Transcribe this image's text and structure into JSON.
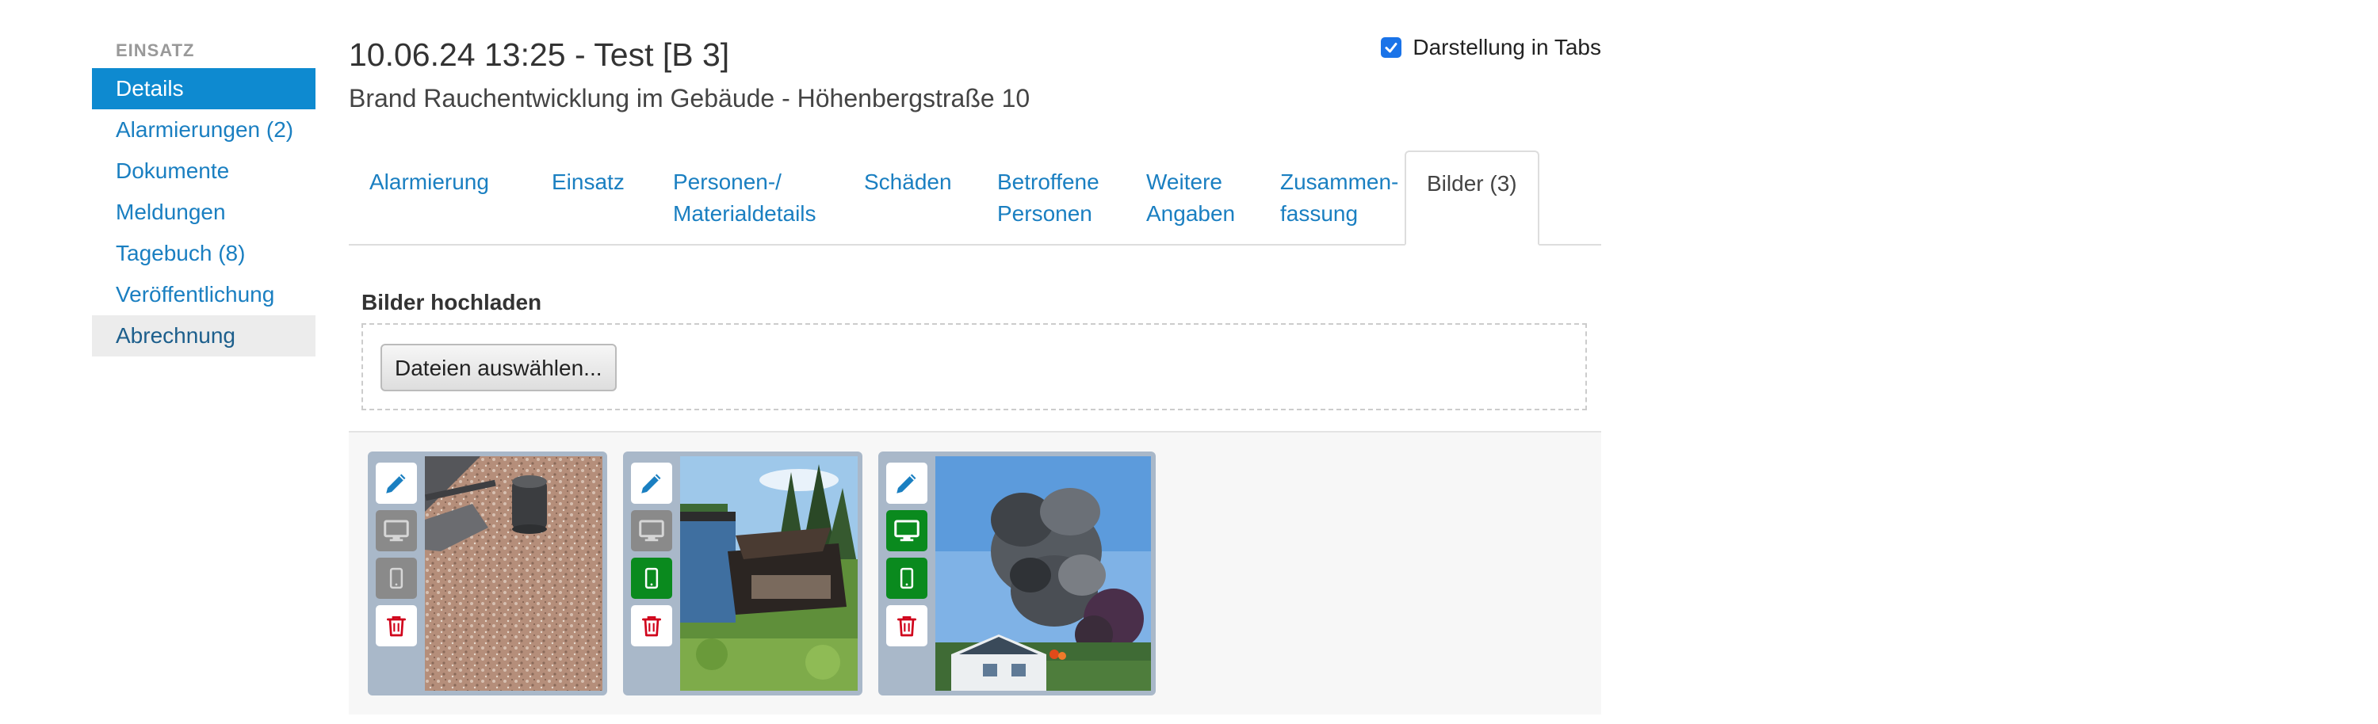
{
  "sidebar": {
    "heading": "EINSATZ",
    "items": [
      {
        "label": "Details",
        "state": "active"
      },
      {
        "label": "Alarmierungen (2)",
        "state": "normal"
      },
      {
        "label": "Dokumente",
        "state": "normal"
      },
      {
        "label": "Meldungen",
        "state": "normal"
      },
      {
        "label": "Tagebuch (8)",
        "state": "normal"
      },
      {
        "label": "Veröffentlichung",
        "state": "normal"
      },
      {
        "label": "Abrechnung",
        "state": "hover"
      }
    ]
  },
  "header": {
    "title": "10.06.24 13:25 - Test [B 3]",
    "subtitle": "Brand Rauchentwicklung im Gebäude - Höhenbergstraße 10",
    "tabs_toggle_label": "Darstellung in Tabs",
    "tabs_toggle_checked": true
  },
  "tabs": [
    {
      "line1": "Alarmierung",
      "line2": ""
    },
    {
      "line1": "Einsatz",
      "line2": ""
    },
    {
      "line1": "Personen-/",
      "line2": "Materialdetails"
    },
    {
      "line1": "Schäden",
      "line2": ""
    },
    {
      "line1": "Betroffene",
      "line2": "Personen"
    },
    {
      "line1": "Weitere",
      "line2": "Angaben"
    },
    {
      "line1": "Zusammen-",
      "line2": "fassung"
    },
    {
      "line1": "Bilder (3)",
      "line2": "",
      "active": true
    }
  ],
  "upload": {
    "label": "Bilder hochladen",
    "button_label": "Dateien auswählen..."
  },
  "images": [
    {
      "desktop": false,
      "mobile": false
    },
    {
      "desktop": false,
      "mobile": true
    },
    {
      "desktop": true,
      "mobile": true
    }
  ],
  "icons": {
    "edit": "pencil-icon",
    "desktop": "monitor-icon",
    "mobile": "phone-icon",
    "delete": "trash-icon",
    "checkbox": "check-icon"
  },
  "colors": {
    "accent": "#0e8ad0",
    "link": "#1a7fc1",
    "enabled_green": "#0a8a1e",
    "disabled_grey": "#8a8a8a",
    "delete_red": "#d0021b"
  }
}
